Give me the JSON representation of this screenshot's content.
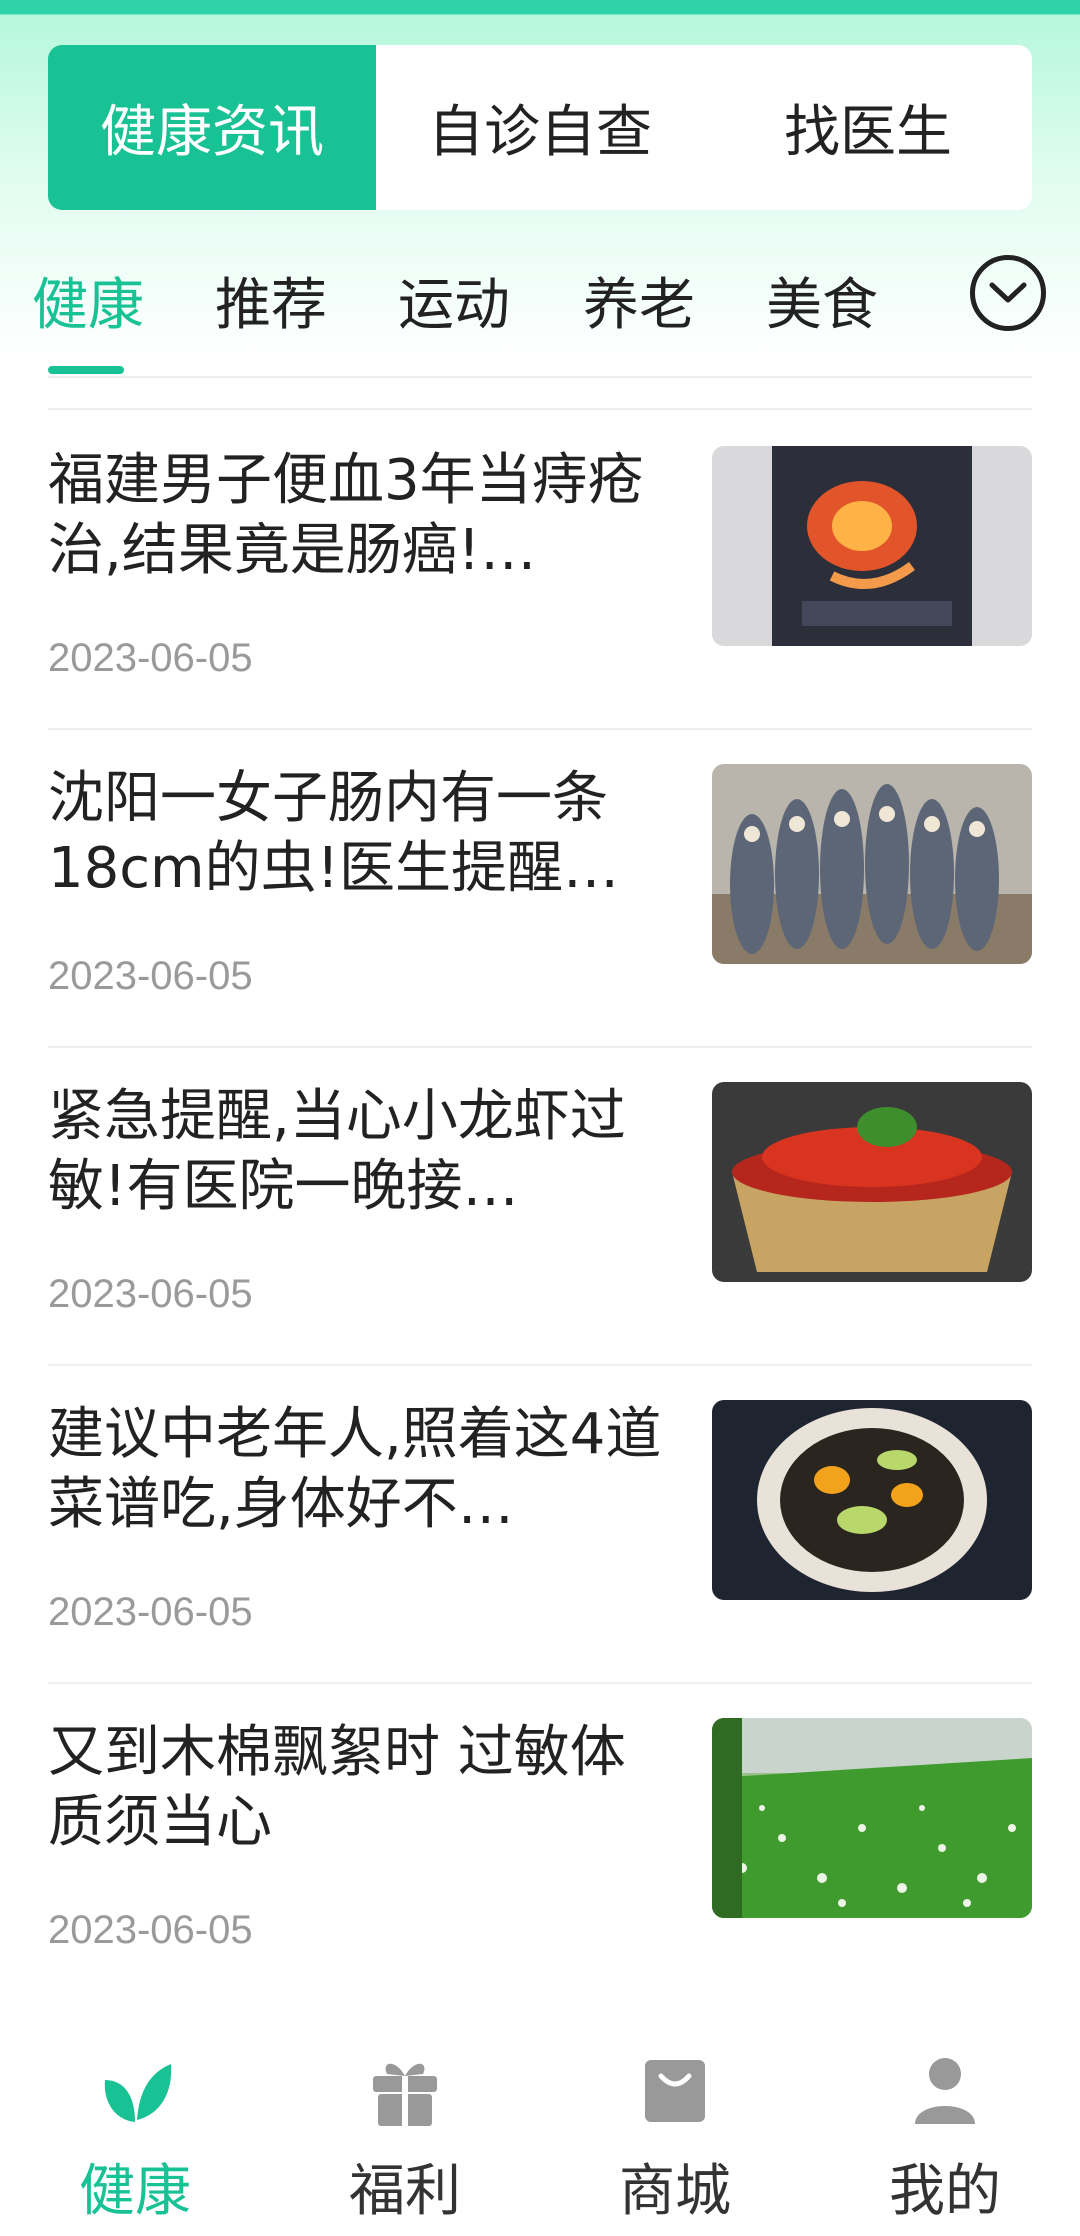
{
  "segments": [
    {
      "label": "健康资讯",
      "active": true
    },
    {
      "label": "自诊自查",
      "active": false
    },
    {
      "label": "找医生",
      "active": false
    }
  ],
  "categories": [
    {
      "label": "健康",
      "active": true
    },
    {
      "label": "推荐",
      "active": false
    },
    {
      "label": "运动",
      "active": false
    },
    {
      "label": "养老",
      "active": false
    },
    {
      "label": "美食",
      "active": false
    }
  ],
  "more_icon": "chevron-down-circle-icon",
  "news": [
    {
      "title": "福建男子便血3年当痔疮治,结果竟是肠癌!…",
      "date": "2023-06-05",
      "thumb": "stomach-illustration"
    },
    {
      "title": "沈阳一女子肠内有一条18cm的虫!医生提醒…",
      "date": "2023-06-05",
      "thumb": "cartoon-cats"
    },
    {
      "title": "紧急提醒,当心小龙虾过敏!有医院一晚接…",
      "date": "2023-06-05",
      "thumb": "crayfish-bowl"
    },
    {
      "title": "建议中老年人,照着这4道菜谱吃,身体好不…",
      "date": "2023-06-05",
      "thumb": "salad-plate"
    },
    {
      "title": "又到木棉飘絮时 过敏体质须当心",
      "date": "2023-06-05",
      "thumb": "cotton-grass"
    }
  ],
  "tabs": [
    {
      "label": "健康",
      "icon": "leaf-icon",
      "active": true
    },
    {
      "label": "福利",
      "icon": "gift-icon",
      "active": false
    },
    {
      "label": "商城",
      "icon": "shopping-bag-icon",
      "active": false
    },
    {
      "label": "我的",
      "icon": "user-icon",
      "active": false
    }
  ],
  "colors": {
    "accent": "#19c294",
    "text": "#222222",
    "muted": "#9a9a9a"
  }
}
